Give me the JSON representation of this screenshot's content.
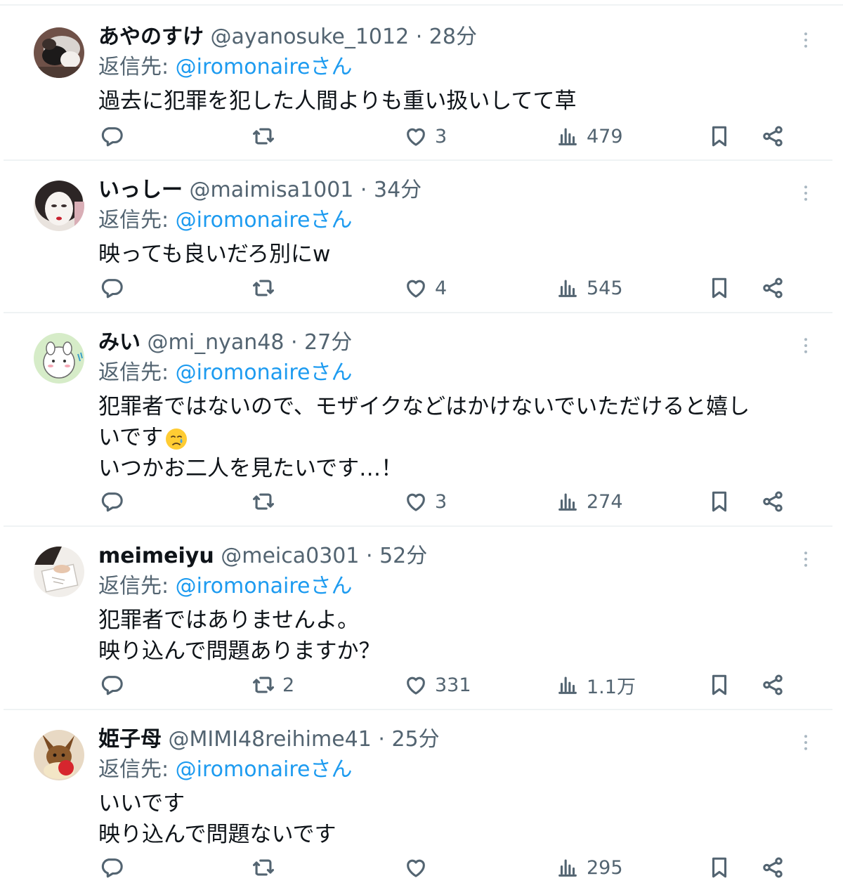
{
  "colors": {
    "accent": "#1d9bf0",
    "text_primary": "#0f1419",
    "text_secondary": "#536471",
    "divider": "#eff3f4"
  },
  "icons": {
    "reply": "reply-icon",
    "retweet": "retweet-icon",
    "like": "heart-icon",
    "views": "views-bar-chart-icon",
    "bookmark": "bookmark-icon",
    "share": "share-icon",
    "more": "more-vertical-icon"
  },
  "tweets": [
    {
      "display_name": "あやのすけ",
      "handle_time": " @ayanosuke_1012 · 28分",
      "reply_prefix": "返信先: ",
      "reply_mention": "@iromonaireさん",
      "body_lines": [
        "過去に犯罪を犯した人間よりも重い扱いしてて草"
      ],
      "stats": {
        "replies": "",
        "retweets": "",
        "likes": "3",
        "views": "479"
      }
    },
    {
      "display_name": "いっしー",
      "handle_time": " @maimisa1001 · 34分",
      "reply_prefix": "返信先: ",
      "reply_mention": "@iromonaireさん",
      "body_lines": [
        "映っても良いだろ別にw"
      ],
      "stats": {
        "replies": "",
        "retweets": "",
        "likes": "4",
        "views": "545"
      }
    },
    {
      "display_name": "みい",
      "handle_time": " @mi_nyan48 · 27分",
      "reply_prefix": "返信先: ",
      "reply_mention": "@iromonaireさん",
      "body_lines": [
        "犯罪者ではないので、モザイクなどはかけないでいただけると嬉し",
        "いです",
        "いつかお二人を見たいです…！"
      ],
      "emoji_name": "crying-face-emoji",
      "stats": {
        "replies": "",
        "retweets": "",
        "likes": "3",
        "views": "274"
      }
    },
    {
      "display_name": "meimeiyu",
      "handle_time": " @meica0301 · 52分",
      "reply_prefix": "返信先: ",
      "reply_mention": "@iromonaireさん",
      "body_lines": [
        "犯罪者ではありませんよ。",
        "映り込んで問題ありますか？"
      ],
      "stats": {
        "replies": "",
        "retweets": "2",
        "likes": "331",
        "views": "1.1万"
      }
    },
    {
      "display_name": "姫子母",
      "handle_time": " @MIMI48reihime41 · 25分",
      "reply_prefix": "返信先: ",
      "reply_mention": "@iromonaireさん",
      "body_lines": [
        "いいです",
        "映り込んで問題ないです"
      ],
      "stats": {
        "replies": "",
        "retweets": "",
        "likes": "",
        "views": "295"
      }
    }
  ]
}
